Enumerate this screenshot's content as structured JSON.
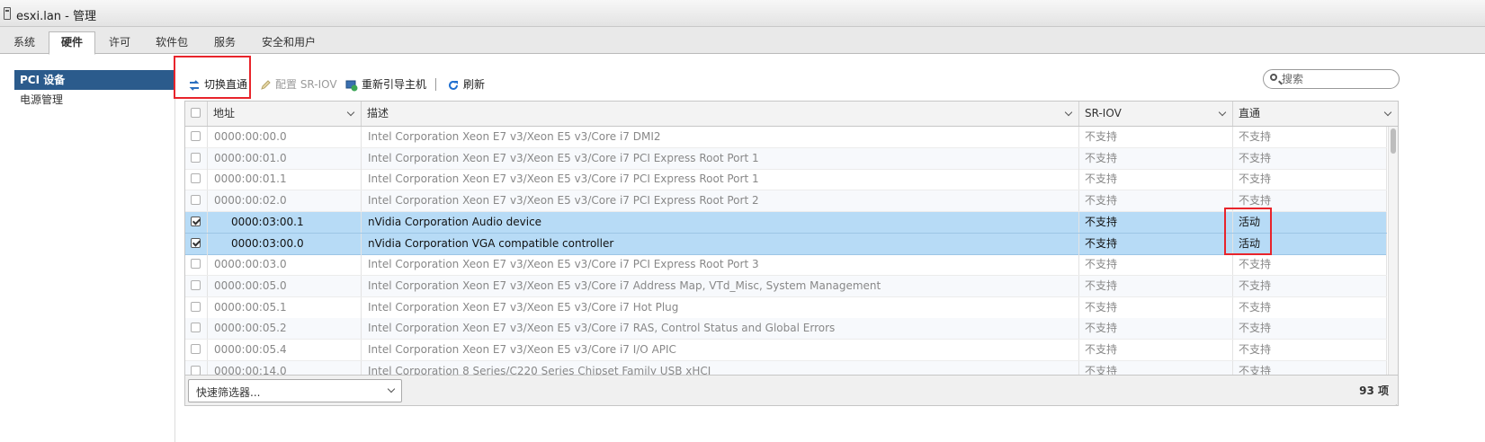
{
  "window": {
    "title": "esxi.lan - 管理"
  },
  "tabs": [
    {
      "label": "系统"
    },
    {
      "label": "硬件",
      "active": true
    },
    {
      "label": "许可"
    },
    {
      "label": "软件包"
    },
    {
      "label": "服务"
    },
    {
      "label": "安全和用户"
    }
  ],
  "sidebar": {
    "items": [
      {
        "label": "PCI 设备",
        "active": true
      },
      {
        "label": "电源管理"
      }
    ]
  },
  "toolbar": {
    "toggle_passthrough": "切换直通",
    "configure_sriov": "配置 SR-IOV",
    "reboot_host": "重新引导主机",
    "refresh": "刷新"
  },
  "search": {
    "placeholder": "搜索"
  },
  "table": {
    "columns": {
      "address": "地址",
      "description": "描述",
      "sriov": "SR-IOV",
      "passthrough": "直通"
    },
    "rows": [
      {
        "address": "0000:00:00.0",
        "description": "Intel Corporation Xeon E7 v3/Xeon E5 v3/Core i7 DMI2",
        "sriov": "不支持",
        "passthrough": "不支持",
        "checked": false
      },
      {
        "address": "0000:00:01.0",
        "description": "Intel Corporation Xeon E7 v3/Xeon E5 v3/Core i7 PCI Express Root Port 1",
        "sriov": "不支持",
        "passthrough": "不支持",
        "checked": false
      },
      {
        "address": "0000:00:01.1",
        "description": "Intel Corporation Xeon E7 v3/Xeon E5 v3/Core i7 PCI Express Root Port 1",
        "sriov": "不支持",
        "passthrough": "不支持",
        "checked": false
      },
      {
        "address": "0000:00:02.0",
        "description": "Intel Corporation Xeon E7 v3/Xeon E5 v3/Core i7 PCI Express Root Port 2",
        "sriov": "不支持",
        "passthrough": "不支持",
        "checked": false
      },
      {
        "address": "0000:03:00.1",
        "description": "nVidia Corporation Audio device",
        "sriov": "不支持",
        "passthrough": "活动",
        "checked": true,
        "child": true
      },
      {
        "address": "0000:03:00.0",
        "description": "nVidia Corporation VGA compatible controller",
        "sriov": "不支持",
        "passthrough": "活动",
        "checked": true,
        "child": true
      },
      {
        "address": "0000:00:03.0",
        "description": "Intel Corporation Xeon E7 v3/Xeon E5 v3/Core i7 PCI Express Root Port 3",
        "sriov": "不支持",
        "passthrough": "不支持",
        "checked": false
      },
      {
        "address": "0000:00:05.0",
        "description": "Intel Corporation Xeon E7 v3/Xeon E5 v3/Core i7 Address Map, VTd_Misc, System Management",
        "sriov": "不支持",
        "passthrough": "不支持",
        "checked": false
      },
      {
        "address": "0000:00:05.1",
        "description": "Intel Corporation Xeon E7 v3/Xeon E5 v3/Core i7 Hot Plug",
        "sriov": "不支持",
        "passthrough": "不支持",
        "checked": false
      },
      {
        "address": "0000:00:05.2",
        "description": "Intel Corporation Xeon E7 v3/Xeon E5 v3/Core i7 RAS, Control Status and Global Errors",
        "sriov": "不支持",
        "passthrough": "不支持",
        "checked": false
      },
      {
        "address": "0000:00:05.4",
        "description": "Intel Corporation Xeon E7 v3/Xeon E5 v3/Core i7 I/O APIC",
        "sriov": "不支持",
        "passthrough": "不支持",
        "checked": false
      },
      {
        "address": "0000:00:14.0",
        "description": "Intel Corporation 8 Series/C220 Series Chipset Family USB xHCI",
        "sriov": "不支持",
        "passthrough": "不支持",
        "checked": false
      }
    ]
  },
  "footer": {
    "quick_filter": "快速筛选器...",
    "item_count": "93 项"
  },
  "icons": {
    "toggle": "swap-arrows-icon",
    "configure": "pencil-icon",
    "reboot": "reboot-host-icon",
    "refresh": "refresh-icon",
    "search": "search-icon",
    "dropdown": "chevron-down-icon"
  },
  "colors": {
    "selected_row": "#b7dbf6",
    "sidebar_active": "#2b5b8c",
    "highlight_box": "#e8242b"
  }
}
